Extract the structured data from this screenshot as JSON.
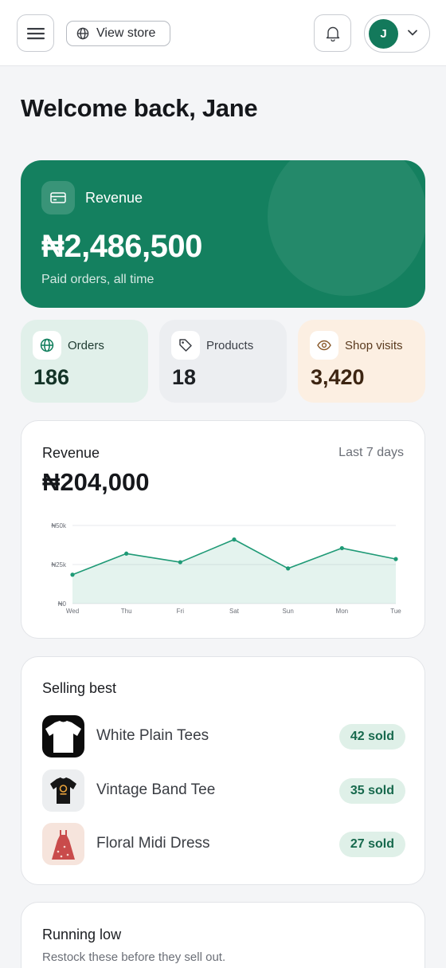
{
  "header": {
    "view_store_label": "View store",
    "avatar_initial": "J"
  },
  "page": {
    "title": "Welcome back, Jane"
  },
  "revenue_card": {
    "label": "Revenue",
    "amount": "₦2,486,500",
    "subtitle": "Paid orders, all time"
  },
  "stats": [
    {
      "label": "Orders",
      "value": "186",
      "icon": "globe-icon"
    },
    {
      "label": "Products",
      "value": "18",
      "icon": "tag-icon"
    },
    {
      "label": "Shop visits",
      "value": "3,420",
      "icon": "eye-icon"
    }
  ],
  "revenue_chart": {
    "title": "Revenue",
    "period": "Last 7 days",
    "total": "₦204,000"
  },
  "chart_data": {
    "type": "area",
    "categories": [
      "Wed",
      "Thu",
      "Fri",
      "Sat",
      "Sun",
      "Mon",
      "Tue"
    ],
    "values": [
      18500,
      32000,
      26500,
      41000,
      22500,
      35500,
      28500
    ],
    "y_ticks": [
      "₦0",
      "₦25k",
      "₦50k"
    ],
    "ylim": [
      0,
      50000
    ],
    "grid": true,
    "color": "#1f9a76"
  },
  "selling_best": {
    "title": "Selling best",
    "items": [
      {
        "name": "White Plain Tees",
        "sold": "42 sold"
      },
      {
        "name": "Vintage Band Tee",
        "sold": "35 sold"
      },
      {
        "name": "Floral Midi Dress",
        "sold": "27 sold"
      }
    ]
  },
  "running_low": {
    "title": "Running low",
    "subtitle": "Restock these before they sell out."
  },
  "colors": {
    "brand": "#14805f",
    "orders_bg": "#e1f0ea",
    "products_bg": "#eceef1",
    "visits_bg": "#fcefe2",
    "badge_bg": "#dff0e8"
  }
}
